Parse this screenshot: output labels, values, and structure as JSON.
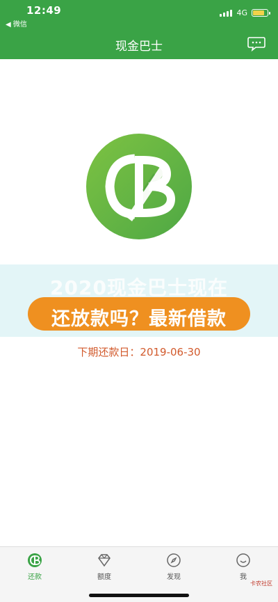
{
  "status_bar": {
    "time": "12:49",
    "back_app": "◀ 微信",
    "network": "4G",
    "battery_level": 0.8
  },
  "nav": {
    "title": "现金巴士",
    "chat_icon": "chat-bubble-icon"
  },
  "logo": {
    "icon": "cash-bus-cb-logo",
    "color": "#5fb44a"
  },
  "banner": {
    "faded_text": "2020现金巴士现在",
    "main_text": "还放款吗？最新借款",
    "pill_color": "#ef9020"
  },
  "repayment": {
    "due_text": "下期还款日：2019-06-30"
  },
  "tabs": [
    {
      "label": "还款",
      "icon": "cb-logo-icon",
      "active": true
    },
    {
      "label": "额度",
      "icon": "diamond-icon",
      "active": false
    },
    {
      "label": "发现",
      "icon": "compass-icon",
      "active": false
    },
    {
      "label": "我",
      "icon": "smiley-icon",
      "active": false
    }
  ],
  "watermark": "卡农社区",
  "colors": {
    "primary_green": "#3aa346",
    "due_text": "#d25a2c"
  }
}
